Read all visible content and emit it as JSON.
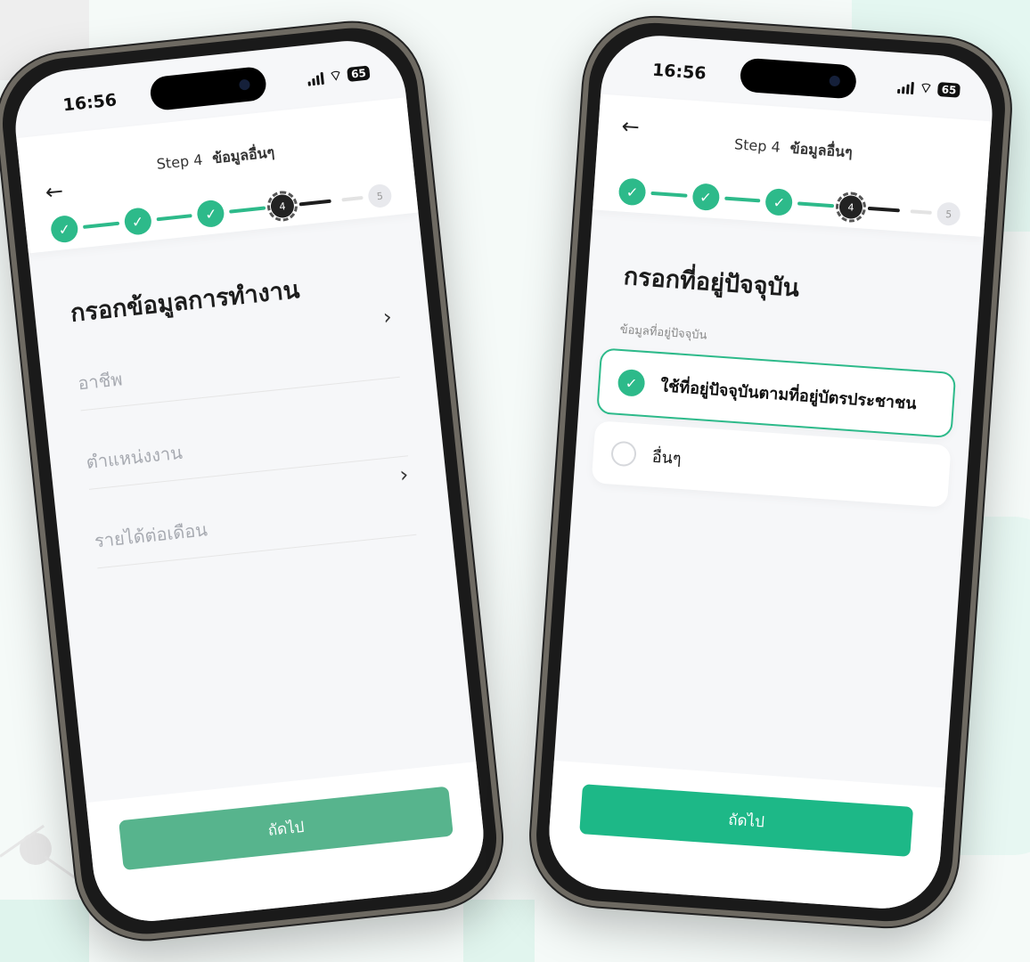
{
  "status": {
    "time": "16:56",
    "battery": "65"
  },
  "header": {
    "step_label": "Step 4",
    "step_name": "ข้อมูลอื่นๆ"
  },
  "stepper": {
    "current": "4",
    "next": "5"
  },
  "left_screen": {
    "title": "กรอกข้อมูลการทำงาน",
    "fields": [
      {
        "label": "อาชีพ"
      },
      {
        "label": "ตำแหน่งงาน"
      },
      {
        "label": "รายได้ต่อเดือน"
      }
    ],
    "next_label": "ถัดไป"
  },
  "right_screen": {
    "title": "กรอกที่อยู่ปัจจุบัน",
    "sub_label": "ข้อมูลที่อยู่ปัจจุบัน",
    "options": [
      {
        "label": "ใช้ที่อยู่ปัจจุบันตามที่อยู่บัตรประชาชน",
        "selected": true
      },
      {
        "label": "อื่นๆ",
        "selected": false
      }
    ],
    "next_label": "ถัดไป"
  },
  "colors": {
    "accent": "#2dba8a",
    "button_light": "#57b48d",
    "button_strong": "#1db887"
  }
}
